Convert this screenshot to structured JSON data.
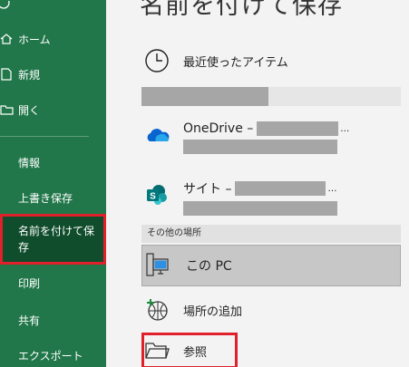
{
  "nav": {
    "items": [
      {
        "label": "ホーム",
        "icon": "home-icon"
      },
      {
        "label": "新規",
        "icon": "new-document-icon"
      },
      {
        "label": "開く",
        "icon": "open-folder-icon"
      },
      {
        "label": "情報"
      },
      {
        "label": "上書き保存"
      },
      {
        "label": "名前を付けて保存",
        "selected": true
      },
      {
        "label": "印刷"
      },
      {
        "label": "共有"
      },
      {
        "label": "エクスポート"
      }
    ]
  },
  "panel": {
    "title": "名前を付けて保存",
    "recent": {
      "label": "最近使ったアイテム",
      "icon": "clock-icon"
    },
    "onedrive": {
      "label": "OneDrive –",
      "ellipsis": "…",
      "icon": "onedrive-cloud-icon"
    },
    "sites": {
      "label": "サイト –",
      "ellipsis": "…",
      "icon": "sharepoint-icon"
    },
    "other_locations_label": "その他の場所",
    "this_pc": {
      "label": "この PC",
      "icon": "computer-icon"
    },
    "add_place": {
      "label": "場所の追加",
      "icon": "add-place-icon"
    },
    "browse": {
      "label": "参照",
      "icon": "folder-icon"
    }
  },
  "colors": {
    "nav_bg": "#21774a",
    "nav_selected_bg": "#0f4d2c",
    "highlight_outline": "#e0202a",
    "panel_bg": "#f3f3f3"
  }
}
